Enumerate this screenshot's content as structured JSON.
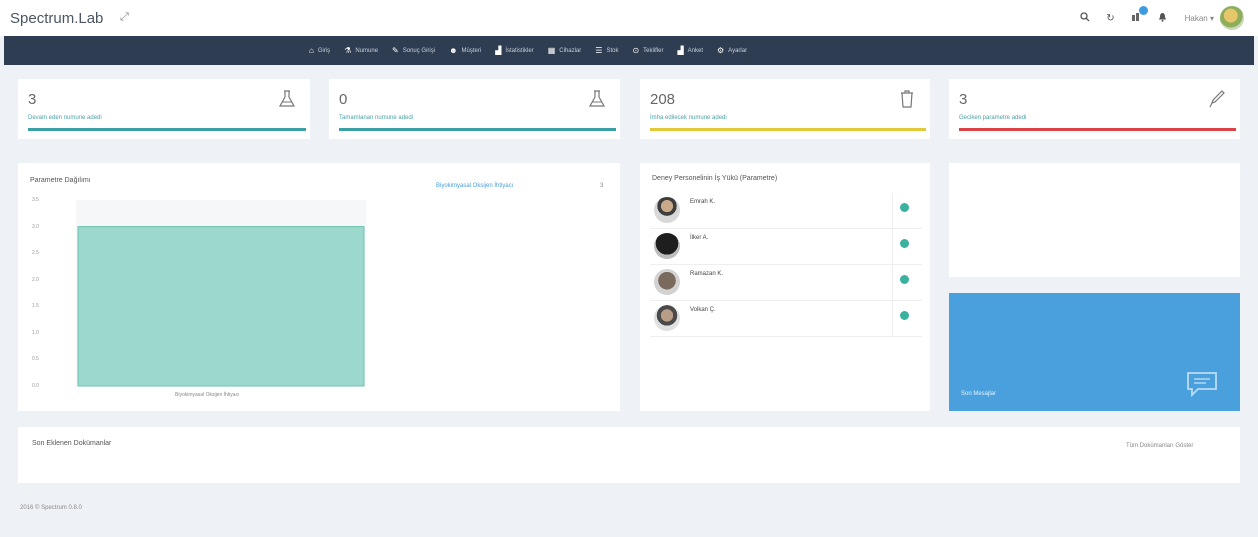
{
  "header": {
    "brand": "Spectrum.Lab",
    "username": "Hakan",
    "expand_icon": "expand-icon",
    "icons": [
      "search-icon",
      "refresh-icon",
      "notifications-icon",
      "bell-icon"
    ]
  },
  "nav": {
    "items": [
      {
        "icon": "home-icon",
        "glyph": "⌂",
        "label": "Giriş"
      },
      {
        "icon": "flask-icon",
        "glyph": "⚗",
        "label": "Numune"
      },
      {
        "icon": "pen-icon",
        "glyph": "✎",
        "label": "Sonuç Girişi"
      },
      {
        "icon": "user-icon",
        "glyph": "☻",
        "label": "Müşteri"
      },
      {
        "icon": "stats-icon",
        "glyph": "▟",
        "label": "İstatistikler"
      },
      {
        "icon": "cihazlar-icon",
        "glyph": "▦",
        "label": "Cihazlar"
      },
      {
        "icon": "stok-icon",
        "glyph": "☰",
        "label": "Stok"
      },
      {
        "icon": "teklif-icon",
        "glyph": "⊙",
        "label": "Teklifler"
      },
      {
        "icon": "anket-icon",
        "glyph": "▟",
        "label": "Anket"
      },
      {
        "icon": "settings-icon",
        "glyph": "⚙",
        "label": "Ayarlar"
      }
    ]
  },
  "stats": [
    {
      "value": "3",
      "label": "Devam eden numune adedi",
      "color": "#3aa0a6",
      "icon": "flask-icon"
    },
    {
      "value": "0",
      "label": "Tamamlanan numune adedi",
      "color": "#3aa0a6",
      "icon": "flask-icon"
    },
    {
      "value": "208",
      "label": "İmha edilecek numune adedi",
      "color": "#e3c839",
      "icon": "trash-icon"
    },
    {
      "value": "3",
      "label": "Geciken parametre adedi",
      "color": "#d94343",
      "icon": "eyedropper-icon"
    }
  ],
  "chart_data": {
    "type": "bar",
    "title": "Parametre Dağılımı",
    "categories": [
      "Biyokimyasal Oksijen İhtiyacı"
    ],
    "values": [
      3
    ],
    "legend_label": "Biyokimyasal Oksijen İhtiyacı",
    "legend_value": "3",
    "yticks": [
      "3.5",
      "3.0",
      "2.5",
      "2.0",
      "1.5",
      "1.0",
      "0.5",
      "0.0"
    ],
    "ylim": [
      0,
      3.5
    ],
    "bar_color": "#9dd8cc",
    "bar_border": "#6cc3b2",
    "legend_placement": "top-right"
  },
  "workload": {
    "title": "Deney Personelinin İş Yükü (Parametre)",
    "people": [
      {
        "name": "Emrah K."
      },
      {
        "name": "İlker A."
      },
      {
        "name": "Ramazan K."
      },
      {
        "name": "Volkan Ç."
      }
    ]
  },
  "messages": {
    "label": "Son Mesajlar",
    "color": "#4aa0dc"
  },
  "documents": {
    "title": "Son Eklenen Dokümanlar",
    "link": "Tüm Dokümanları Göster"
  },
  "footer": {
    "text": "2016 © Spectrum 0.8.0"
  }
}
